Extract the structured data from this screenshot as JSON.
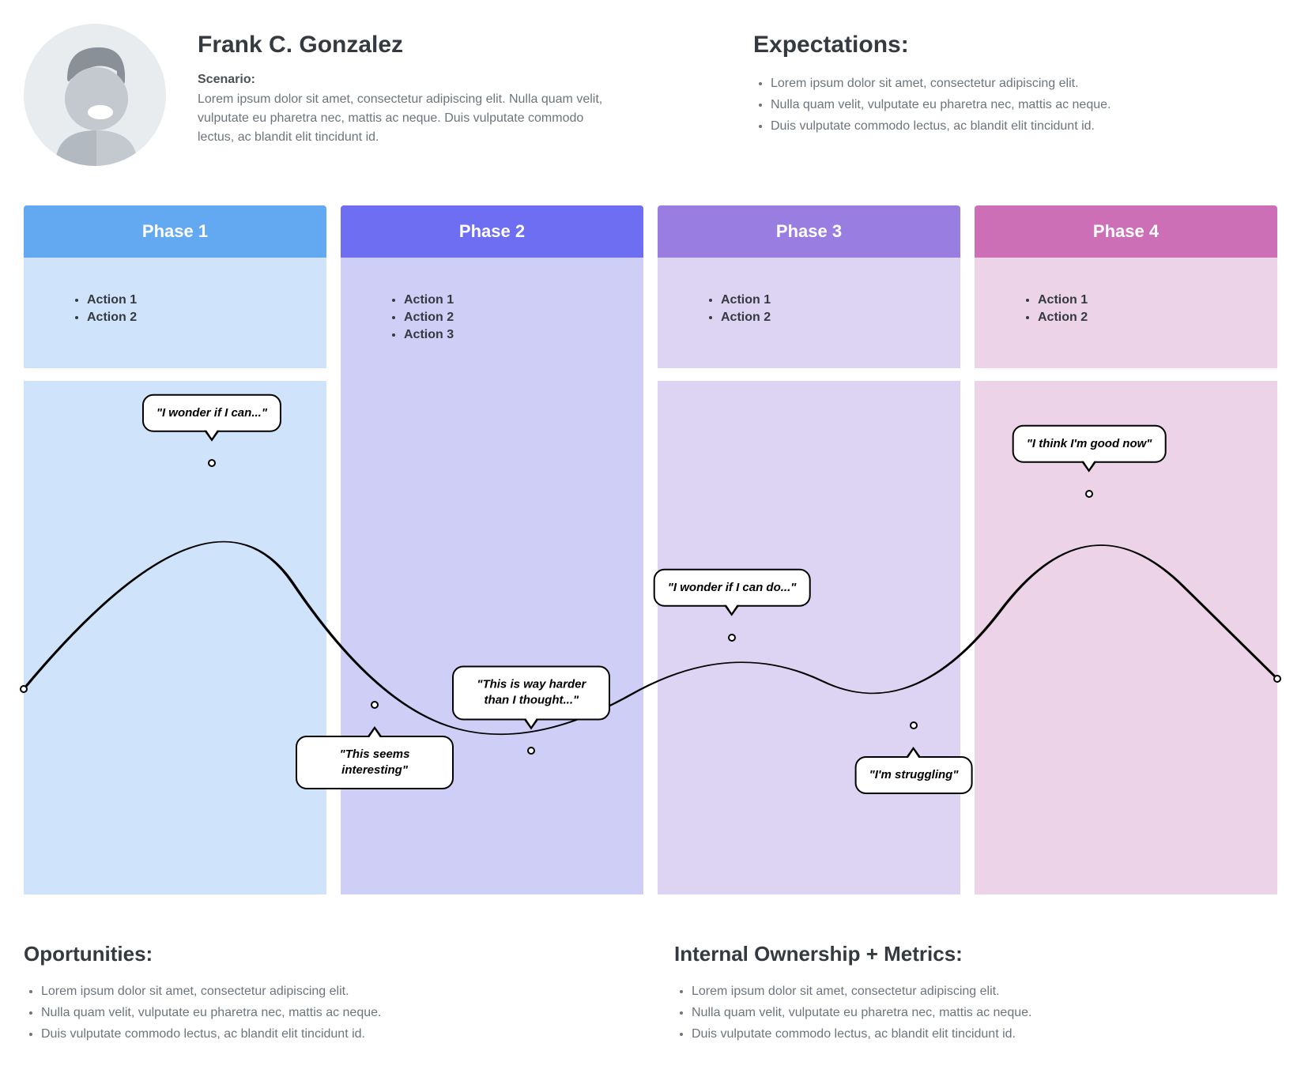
{
  "persona": {
    "name": "Frank C. Gonzalez",
    "scenario_label": "Scenario:",
    "scenario_text": "Lorem ipsum dolor sit amet, consectetur adipiscing elit. Nulla quam velit, vulputate eu pharetra nec, mattis ac neque. Duis vulputate commodo lectus, ac blandit elit tincidunt id."
  },
  "expectations": {
    "title": "Expectations:",
    "items": [
      "Lorem ipsum dolor sit amet, consectetur adipiscing elit.",
      "Nulla quam velit, vulputate eu pharetra nec, mattis ac neque.",
      "Duis vulputate commodo lectus, ac blandit elit tincidunt id."
    ]
  },
  "phases": [
    {
      "label": "Phase 1",
      "header_color": "#63a9f2",
      "body_color": "#cfe4fb",
      "actions": [
        "Action 1",
        "Action 2"
      ]
    },
    {
      "label": "Phase 2",
      "header_color": "#6d6ef2",
      "body_color": "#cfcef6",
      "actions": [
        "Action 1",
        "Action 2",
        "Action 3"
      ]
    },
    {
      "label": "Phase 3",
      "header_color": "#9a7de0",
      "body_color": "#ddd4f4",
      "actions": [
        "Action 1",
        "Action 2"
      ]
    },
    {
      "label": "Phase 4",
      "header_color": "#cc6fb7",
      "body_color": "#ecd3e7",
      "actions": [
        "Action 1",
        "Action 2"
      ]
    }
  ],
  "journey": {
    "bubbles": [
      {
        "text": "\"I wonder if I can...\"",
        "x_pct": 15.0,
        "y_pct": 16,
        "placement": "above"
      },
      {
        "text": "\"This seems interesting\"",
        "x_pct": 28.0,
        "y_pct": 63,
        "placement": "below"
      },
      {
        "text": "\"This is way harder than I thought...\"",
        "x_pct": 40.5,
        "y_pct": 72,
        "placement": "above"
      },
      {
        "text": "\"I wonder if I can do...\"",
        "x_pct": 56.5,
        "y_pct": 50,
        "placement": "above"
      },
      {
        "text": "\"I'm struggling\"",
        "x_pct": 71.0,
        "y_pct": 67,
        "placement": "below"
      },
      {
        "text": "\"I think I'm good now\"",
        "x_pct": 85.0,
        "y_pct": 22,
        "placement": "above"
      }
    ],
    "curve_color": "#000000"
  },
  "chart_data": {
    "type": "line",
    "title": "User journey emotional curve",
    "xlabel": "",
    "ylabel": "",
    "x": [
      0,
      15,
      28,
      40.5,
      56.5,
      71,
      85,
      100
    ],
    "values": [
      60,
      16,
      63,
      72,
      50,
      67,
      22,
      58
    ],
    "note": "y is 0=top/positive, 100=bottom/negative as drawn"
  },
  "footer": {
    "opportunities": {
      "title": "Oportunities:",
      "items": [
        "Lorem ipsum dolor sit amet, consectetur adipiscing elit.",
        "Nulla quam velit, vulputate eu pharetra nec, mattis ac neque.",
        "Duis vulputate commodo lectus, ac blandit elit tincidunt id."
      ]
    },
    "ownership": {
      "title": "Internal Ownership + Metrics:",
      "items": [
        "Lorem ipsum dolor sit amet, consectetur adipiscing elit.",
        "Nulla quam velit, vulputate eu pharetra nec, mattis ac neque.",
        "Duis vulputate commodo lectus, ac blandit elit tincidunt id."
      ]
    }
  }
}
